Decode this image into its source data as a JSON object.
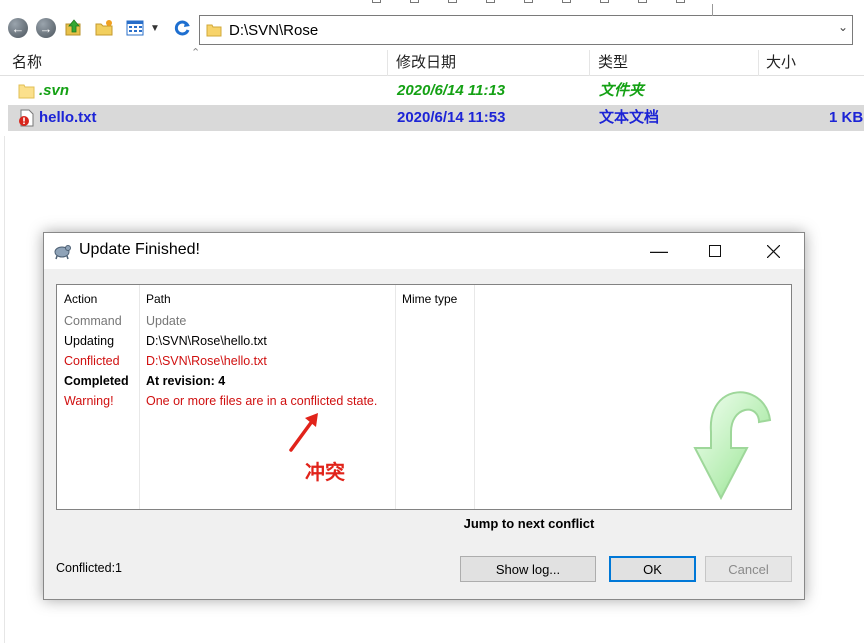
{
  "explorer": {
    "address_path": "D:\\SVN\\Rose",
    "columns": [
      "名称",
      "修改日期",
      "类型",
      "大小"
    ],
    "files": [
      {
        "name": ".svn",
        "date": "2020/6/14 11:13",
        "type": "文件夹",
        "size": ""
      },
      {
        "name": "hello.txt",
        "date": "2020/6/14 11:53",
        "type": "文本文档",
        "size": "1 KB"
      }
    ]
  },
  "dialog": {
    "title": "Update Finished!",
    "columns": [
      "Action",
      "Path",
      "Mime type"
    ],
    "rows": [
      {
        "action": "Command",
        "path": "Update",
        "style": "gray"
      },
      {
        "action": "Updating",
        "path": "D:\\SVN\\Rose\\hello.txt",
        "style": "normal"
      },
      {
        "action": "Conflicted",
        "path": "D:\\SVN\\Rose\\hello.txt",
        "style": "red"
      },
      {
        "action": "Completed",
        "path": "At revision: 4",
        "style": "bold"
      },
      {
        "action": "Warning!",
        "path": "One or more files are in a conflicted state.",
        "style": "red"
      }
    ],
    "annotation": "冲突",
    "jump_label": "Jump to next conflict",
    "status": "Conflicted:1",
    "buttons": {
      "show_log": "Show log...",
      "ok": "OK",
      "cancel": "Cancel"
    }
  },
  "colors": {
    "svn_green": "#14a114",
    "conflict_blue": "#1c24d6",
    "warning_red": "#d01010",
    "annotation_red": "#e1231a"
  }
}
